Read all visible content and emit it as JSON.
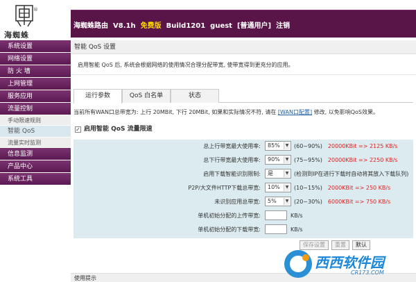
{
  "header": {
    "logo_text": "海蜘蛛",
    "logo_reg": "®",
    "product": "海蜘蛛路由",
    "version": "V8.1h",
    "edition": "免费版",
    "build": "Build1201",
    "user": "guest",
    "role": "[普通用户]",
    "logout": "注销"
  },
  "sidebar": {
    "items": [
      {
        "label": "系统设置"
      },
      {
        "label": "网络设置"
      },
      {
        "label": "防 火 墙"
      },
      {
        "label": "上网管理"
      },
      {
        "label": "服务应用"
      },
      {
        "label": "流量控制"
      }
    ],
    "subitems": [
      {
        "label": "手动限速规则"
      },
      {
        "label": "智能 QoS"
      },
      {
        "label": "流量实时监测"
      }
    ],
    "items_after": [
      {
        "label": "信息监测"
      },
      {
        "label": "产品中心"
      },
      {
        "label": "系统工具"
      }
    ]
  },
  "main": {
    "title": "智能 QoS 设置",
    "description": "启用智能 QoS 后, 系统会根据网络的使用情况合理分配带宽, 使带宽得到更充分的应用。",
    "tabs": [
      {
        "label": "运行参数"
      },
      {
        "label": "QoS 白名单"
      },
      {
        "label": "状态"
      }
    ],
    "bandwidth_prefix": "当前所有WAN口总带宽为: 上行 20MBit, 下行 20MBit, 如果和实际情况不符, 请在",
    "bandwidth_link": "[WAN口配置]",
    "bandwidth_suffix": "修改, 以免影响QoS效果。",
    "enable_label": "启用智能 QoS 流量限速",
    "enable_check": "✓",
    "rows": [
      {
        "label": "总上行带宽最大使用率:",
        "select": "85%",
        "hint": "(60~90%)",
        "rate": "20000KBit => 2125 KB/s"
      },
      {
        "label": "总下行带宽最大使用率:",
        "select": "90%",
        "hint": "(75~95%)",
        "rate": "20000KBit => 2250 KB/s"
      },
      {
        "label": "启用下载智能识别限制:",
        "select": "是",
        "hint": "(检测到IP在进行下载时自动将其放入下载队列)",
        "rate": ""
      },
      {
        "label": "P2P/大文件HTTP下载总带宽:",
        "select": "10%",
        "hint": "(10~15%)",
        "rate": "2000KBit => 250 KB/s"
      },
      {
        "label": "未识别应用总带宽:",
        "select": "5%",
        "hint": "(20~30%)",
        "rate": "6000KBit => 750 KB/s"
      },
      {
        "label": "单机初始分配的上传带宽:",
        "unit": "KB/s"
      },
      {
        "label": "单机初始分配的下载带宽:",
        "unit": "KB/s"
      }
    ],
    "buttons": {
      "save": "保存设置",
      "reset": "重置",
      "default": "默认"
    },
    "footer": "使用提示"
  },
  "watermark": {
    "text": "西西软件园",
    "sub": "CR173.COM"
  },
  "colors": {
    "topbar": "#5a1548",
    "sidebar": "#6b2562",
    "settings_bg": "#dcebef",
    "rate_red": "#dd2222",
    "link_blue": "#1f5fa0"
  }
}
